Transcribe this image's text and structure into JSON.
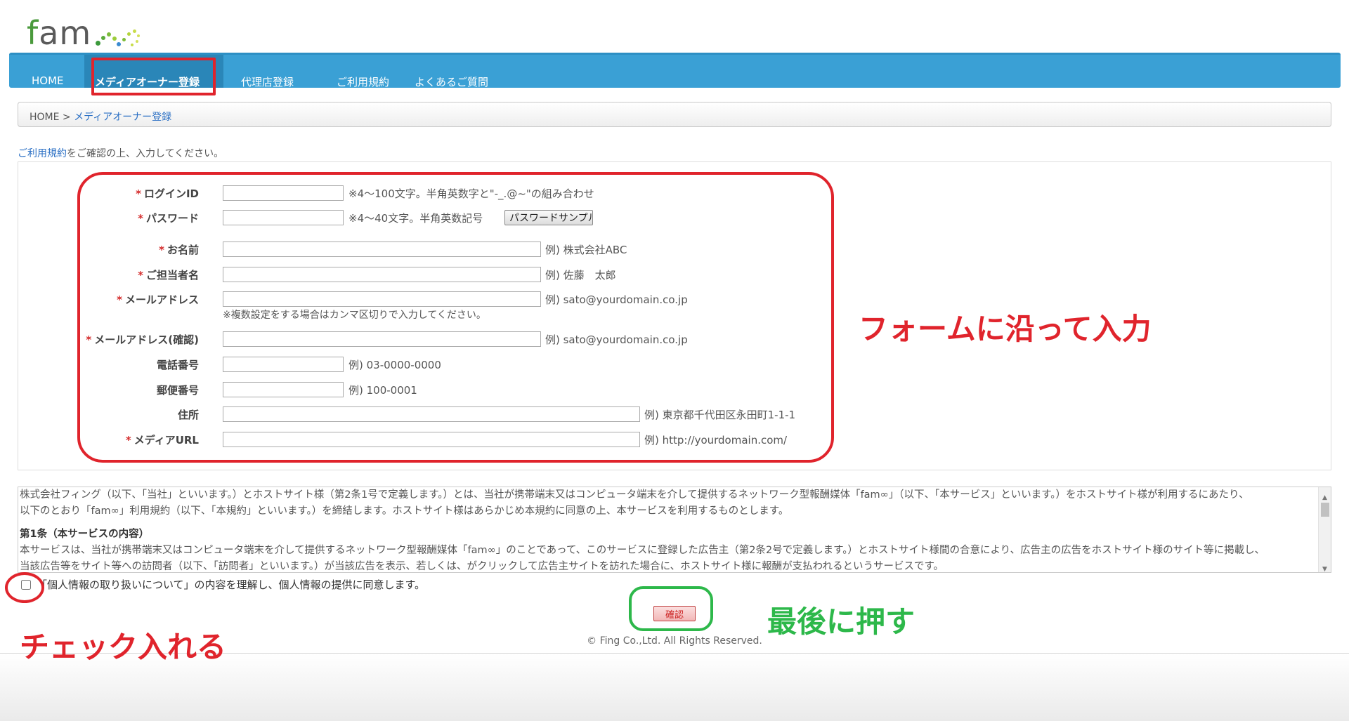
{
  "logo": {
    "text": "fam"
  },
  "nav": {
    "items": [
      {
        "label": "HOME"
      },
      {
        "label": "メディアオーナー登録"
      },
      {
        "label": "代理店登録"
      },
      {
        "label": "ご利用規約"
      },
      {
        "label": "よくあるご質問"
      }
    ]
  },
  "breadcrumb": {
    "home": "HOME",
    "sep": " > ",
    "current": "メディアオーナー登録"
  },
  "intro": {
    "link": "ご利用規約",
    "text": "をご確認の上、入力してください。"
  },
  "form": {
    "required_mark": "*",
    "login_id": {
      "label": "ログインID",
      "value": "",
      "hint": "※4～100文字。半角英数字と\"-_.@~\"の組み合わせ"
    },
    "password": {
      "label": "パスワード",
      "value": "",
      "hint": "※4～40文字。半角英数記号",
      "sample_button": "パスワードサンプル"
    },
    "name": {
      "label": "お名前",
      "value": "",
      "hint": "例) 株式会社ABC"
    },
    "contact": {
      "label": "ご担当者名",
      "value": "",
      "hint": "例) 佐藤　太郎"
    },
    "email": {
      "label": "メールアドレス",
      "value": "",
      "hint": "例) sato@yourdomain.co.jp",
      "note": "※複数設定をする場合はカンマ区切りで入力してください。"
    },
    "email_confirm": {
      "label": "メールアドレス(確認)",
      "value": "",
      "hint": "例) sato@yourdomain.co.jp"
    },
    "phone": {
      "label": "電話番号",
      "value": "",
      "hint": "例) 03-0000-0000"
    },
    "zip": {
      "label": "郵便番号",
      "value": "",
      "hint": "例) 100-0001"
    },
    "address": {
      "label": "住所",
      "value": "",
      "hint": "例) 東京都千代田区永田町1-1-1"
    },
    "media_url": {
      "label": "メディアURL",
      "value": "",
      "hint": "例) http://yourdomain.com/"
    }
  },
  "terms": {
    "line1": "株式会社フィング（以下、「当社」といいます。）とホストサイト様（第2条1号で定義します。）とは、当社が携帯端末又はコンピュータ端末を介して提供するネットワーク型報酬媒体「fam∞」（以下、「本サービス」といいます。）をホストサイト様が利用するにあたり、",
    "line2": "以下のとおり「fam∞」利用規約（以下、「本規約」といいます。）を締結します。ホストサイト様はあらかじめ本規約に同意の上、本サービスを利用するものとします。",
    "section1": "第1条（本サービスの内容）",
    "line3": "本サービスは、当社が携帯端末又はコンピュータ端末を介して提供するネットワーク型報酬媒体「fam∞」のことであって、このサービスに登録した広告主（第2条2号で定義します。）とホストサイト様間の合意により、広告主の広告をホストサイト様のサイト等に掲載し、",
    "line4": "当該広告等をサイト等への訪問者（以下、「訪問者」といいます。）が当該広告を表示、若しくは、がクリックして広告主サイトを訪れた場合に、ホストサイト様に報酬が支払われるというサービスです。"
  },
  "agree": {
    "text": "「個人情報の取り扱いについて」の内容を理解し、個人情報の提供に同意します。",
    "checked": false
  },
  "confirm_button": "確認",
  "footer": {
    "copyright": "© Fing Co.,Ltd. All Rights Reserved."
  },
  "annotations": {
    "form_note": "フォームに沿って入力",
    "check_note": "チェック入れる",
    "last_note": "最後に押す",
    "red": "#e0242c",
    "green": "#2db84a"
  }
}
